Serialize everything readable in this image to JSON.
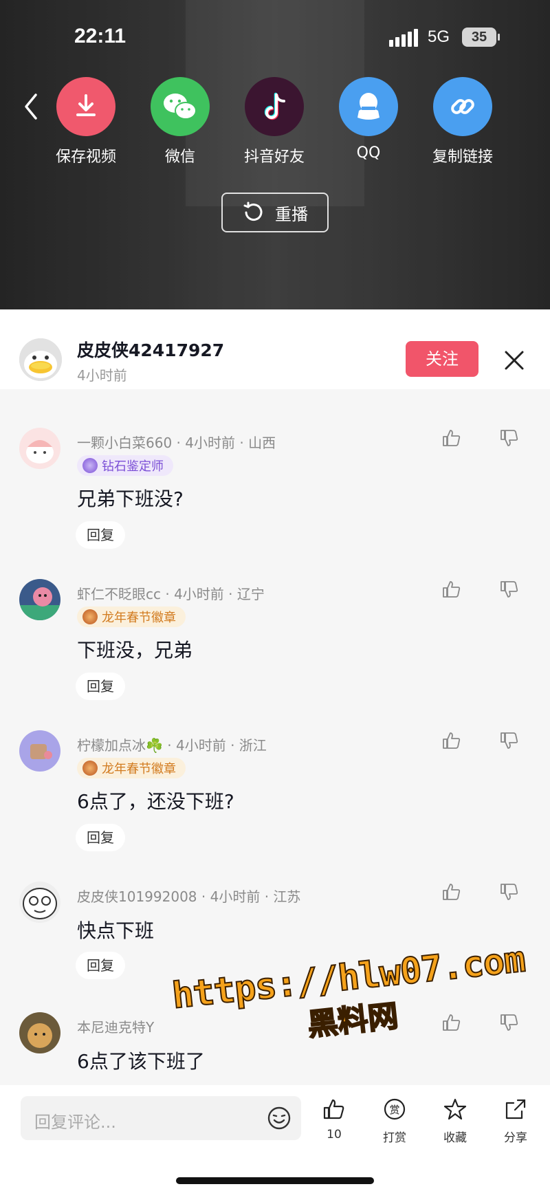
{
  "status_bar": {
    "time": "22:11",
    "network": "5G",
    "battery": "35"
  },
  "share": {
    "items": [
      {
        "label": "保存视频",
        "icon": "download-icon",
        "color": "#f0596d"
      },
      {
        "label": "微信",
        "icon": "wechat-icon",
        "color": "#3fc25e"
      },
      {
        "label": "抖音好友",
        "icon": "douyin-icon",
        "color": "#3b1530"
      },
      {
        "label": "QQ",
        "icon": "qq-icon",
        "color": "#4a9ff0"
      },
      {
        "label": "复制链接",
        "icon": "link-icon",
        "color": "#4a9ff0"
      }
    ],
    "replay_label": "重播"
  },
  "header": {
    "username": "皮皮侠42417927",
    "time": "4小时前",
    "follow_label": "关注"
  },
  "comments": [
    {
      "username": "一颗小白菜660",
      "time": "4小时前",
      "location": "山西",
      "badge": "钻石鉴定师",
      "text": "兄弟下班没?",
      "reply_label": "回复"
    },
    {
      "username": "虾仁不眨眼cc",
      "time": "4小时前",
      "location": "辽宁",
      "badge": "龙年春节徽章",
      "text": "下班没，兄弟",
      "reply_label": "回复"
    },
    {
      "username": "柠檬加点冰☘️",
      "time": "4小时前",
      "location": "浙江",
      "badge": "龙年春节徽章",
      "text": "6点了，还没下班?",
      "reply_label": "回复"
    },
    {
      "username": "皮皮侠101992008",
      "time": "4小时前",
      "location": "江苏",
      "badge": "",
      "text": "快点下班",
      "reply_label": "回复"
    },
    {
      "username": "本尼迪克特Y",
      "time": "",
      "location": "",
      "badge": "",
      "text": "6点了该下班了",
      "reply_label": ""
    }
  ],
  "bottom": {
    "input_placeholder": "回复评论...",
    "like_count": "10",
    "reward_label": "打赏",
    "collect_label": "收藏",
    "share_label": "分享"
  },
  "watermark": {
    "line1": "https://hlw07.com",
    "line2": "黑料网"
  }
}
